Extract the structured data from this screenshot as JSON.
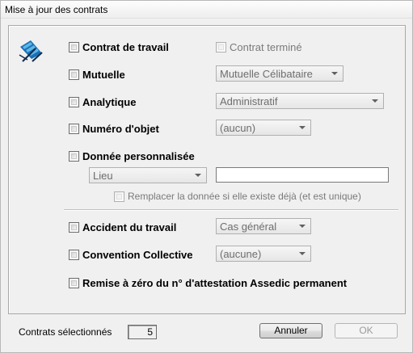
{
  "window": {
    "title": "Mise à jour des contrats"
  },
  "options": {
    "contrat_travail": "Contrat de travail",
    "contrat_termine": "Contrat terminé",
    "mutuelle": "Mutuelle",
    "mutuelle_value": "Mutuelle Célibataire",
    "analytique": "Analytique",
    "analytique_value": "Administratif",
    "numero_objet": "Numéro d'objet",
    "numero_objet_value": "(aucun)",
    "donnee_perso": "Donnée personnalisée",
    "donnee_perso_field": "Lieu",
    "donnee_perso_text": "",
    "remplacer": "Remplacer la donnée si elle existe déjà (et est unique)",
    "accident": "Accident du travail",
    "accident_value": "Cas général",
    "convention": "Convention Collective",
    "convention_value": "(aucune)",
    "remise_zero": "Remise à zéro du n° d'attestation Assedic permanent"
  },
  "footer": {
    "count_label": "Contrats sélectionnés",
    "count_value": "5",
    "cancel_label": "Annuler",
    "ok_label": "OK"
  },
  "icons": {
    "logo": "beach-chair-logo-icon",
    "dropdown": "chevron-down-icon"
  },
  "colors": {
    "logo_blue": "#1a6fb5",
    "logo_light": "#5bb7e8",
    "logo_dark": "#0d2b4a"
  }
}
